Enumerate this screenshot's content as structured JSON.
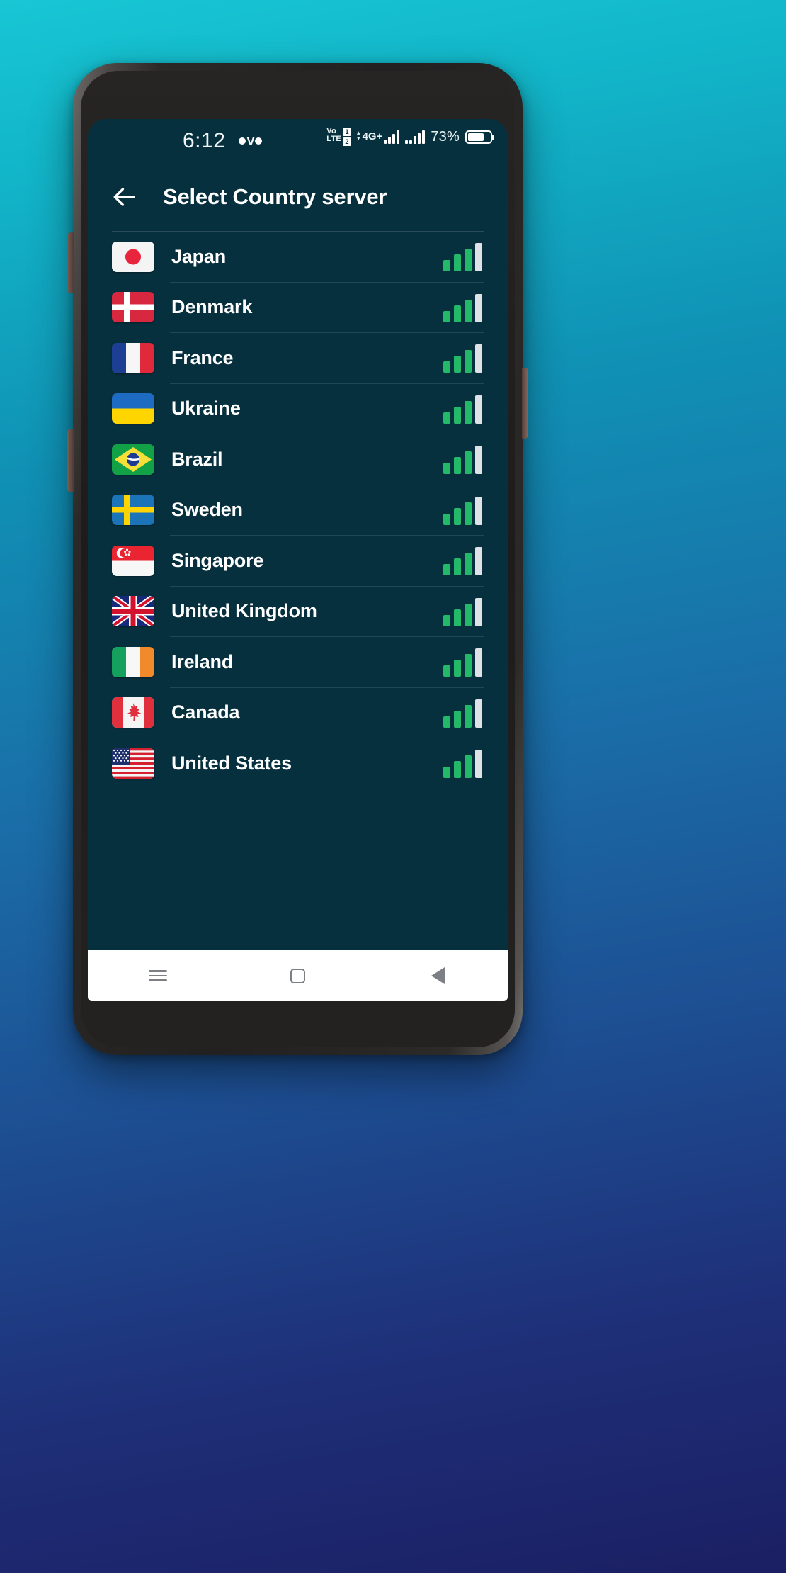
{
  "status_bar": {
    "time": "6:12",
    "notification_icon": "oyo-logo",
    "volte_label": "VoLTE",
    "sim1_badge": "1",
    "sim2_badge": "2",
    "network_type": "4G+",
    "battery_percent": "73%",
    "battery_level": 73
  },
  "header": {
    "back_icon": "arrow-left-icon",
    "title": "Select Country server"
  },
  "servers": [
    {
      "name": "Japan",
      "flag": "jp",
      "signal_bars": 3,
      "signal_total": 4
    },
    {
      "name": "Denmark",
      "flag": "dk",
      "signal_bars": 3,
      "signal_total": 4
    },
    {
      "name": "France",
      "flag": "fr",
      "signal_bars": 3,
      "signal_total": 4
    },
    {
      "name": "Ukraine",
      "flag": "ua",
      "signal_bars": 3,
      "signal_total": 4
    },
    {
      "name": "Brazil",
      "flag": "br",
      "signal_bars": 3,
      "signal_total": 4
    },
    {
      "name": "Sweden",
      "flag": "se",
      "signal_bars": 3,
      "signal_total": 4
    },
    {
      "name": "Singapore",
      "flag": "sg",
      "signal_bars": 3,
      "signal_total": 4
    },
    {
      "name": "United Kingdom",
      "flag": "gb",
      "signal_bars": 3,
      "signal_total": 4
    },
    {
      "name": "Ireland",
      "flag": "ie",
      "signal_bars": 3,
      "signal_total": 4
    },
    {
      "name": "Canada",
      "flag": "ca",
      "signal_bars": 3,
      "signal_total": 4
    },
    {
      "name": "United States",
      "flag": "us",
      "signal_bars": 3,
      "signal_total": 4
    }
  ],
  "nav_bar": {
    "recents_icon": "menu-icon",
    "home_icon": "home-square-icon",
    "back_icon": "back-triangle-icon"
  },
  "colors": {
    "screen_bg": "#07303e",
    "accent_green": "#24b869",
    "inactive_bar": "#dfe3e8",
    "text": "#ffffff",
    "divider": "#20465a"
  }
}
